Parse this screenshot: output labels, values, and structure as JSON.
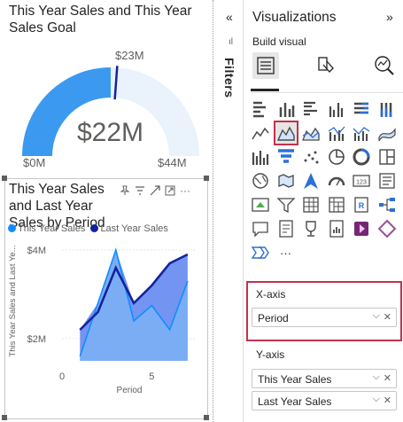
{
  "canvas": {
    "gauge": {
      "title": "This Year Sales and This Year Sales Goal",
      "center_value": "$22M",
      "min_label": "$0M",
      "max_label": "$44M",
      "target_label": "$23M",
      "value_fraction": 0.5,
      "target_fraction": 0.523,
      "fill_color": "#3b9aef",
      "track_color": "#eaf2fb"
    },
    "area_chart": {
      "title": "This Year Sales and Last Year Sales by Period",
      "legend": [
        "This Year Sales",
        "Last Year Sales"
      ]
    }
  },
  "chart_data": {
    "type": "area",
    "title": "This Year Sales and Last Year Sales by Period",
    "xlabel": "Period",
    "ylabel": "This Year Sales and Last Ye...",
    "x_ticks": [
      "0",
      "5"
    ],
    "y_ticks": [
      "$4M",
      "$2M"
    ],
    "xlim": [
      0,
      7.5
    ],
    "ylim": [
      1.5,
      4.2
    ],
    "x": [
      1,
      2,
      3,
      4,
      5,
      6,
      7
    ],
    "series": [
      {
        "name": "This Year Sales",
        "values": [
          1.6,
          2.8,
          4.0,
          2.4,
          2.75,
          2.2,
          3.3
        ],
        "color": "#118dff"
      },
      {
        "name": "Last Year Sales",
        "values": [
          2.2,
          2.6,
          3.6,
          2.8,
          3.2,
          3.7,
          3.9
        ],
        "color": "#12239e"
      }
    ],
    "area_color": "#6b8ef0"
  },
  "filters": {
    "label": "Filters",
    "collapse_glyph": "«",
    "side_glyph": "ıl"
  },
  "visualizations": {
    "title": "Visualizations",
    "expand_glyph": "»",
    "build_visual_label": "Build visual",
    "more_glyph": "···",
    "selected_icon": "area-chart",
    "icons": [
      [
        "stacked-bar-icon",
        "stacked-column-icon",
        "clustered-bar-icon",
        "clustered-column-icon",
        "100-stacked-bar-icon",
        "100-stacked-column-icon"
      ],
      [
        "line-chart-icon",
        "area-chart-icon",
        "stacked-area-icon",
        "line-stacked-column-icon",
        "line-clustered-column-icon",
        "ribbon-chart-icon"
      ],
      [
        "waterfall-icon",
        "funnel-icon",
        "scatter-icon",
        "pie-icon",
        "donut-icon",
        "treemap-icon"
      ],
      [
        "map-icon",
        "filled-map-icon",
        "azure-map-icon",
        "gauge-icon",
        "card-icon",
        "multi-row-card-icon"
      ],
      [
        "kpi-icon",
        "slicer-icon",
        "table-icon",
        "matrix-icon",
        "r-visual-icon",
        "decomposition-tree-icon"
      ],
      [
        "qa-icon",
        "narrative-icon",
        "key-influencers-icon",
        "paginated-report-icon",
        "power-apps-icon",
        "power-automate-icon"
      ],
      [
        "goals-icon"
      ]
    ]
  },
  "wells": {
    "x_axis_label": "X-axis",
    "x_axis_fields": [
      "Period"
    ],
    "y_axis_label": "Y-axis",
    "y_axis_fields": [
      "This Year Sales",
      "Last Year Sales"
    ],
    "highlight_color": "#c4314b"
  }
}
